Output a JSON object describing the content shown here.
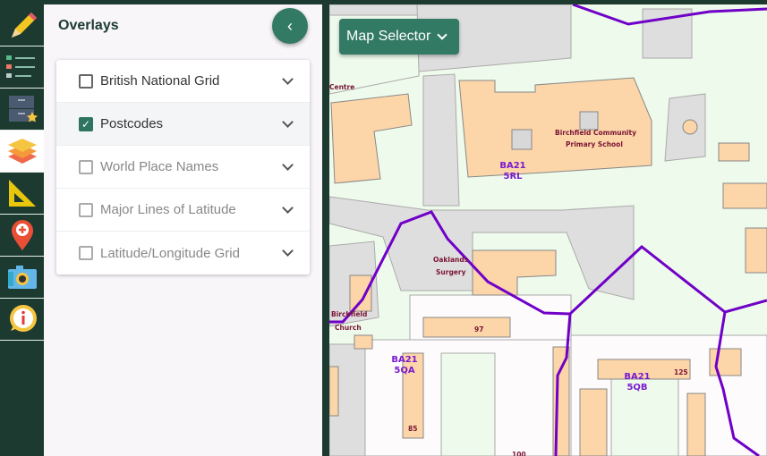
{
  "toolbar": {
    "items": [
      {
        "name": "draw",
        "icon": "pencil-icon"
      },
      {
        "name": "legend",
        "icon": "list-icon"
      },
      {
        "name": "saved-maps",
        "icon": "drawer-star-icon"
      },
      {
        "name": "overlays",
        "icon": "layers-icon",
        "active": true
      },
      {
        "name": "measure",
        "icon": "set-square-icon"
      },
      {
        "name": "add-marker",
        "icon": "map-pin-plus-icon"
      },
      {
        "name": "screenshot",
        "icon": "camera-icon"
      },
      {
        "name": "info",
        "icon": "info-icon"
      }
    ]
  },
  "panel": {
    "title": "Overlays",
    "collapse_icon": "chevron-left-icon",
    "overlays": [
      {
        "label": "British National Grid",
        "checked": false
      },
      {
        "label": "Postcodes",
        "checked": true
      },
      {
        "label": "World Place Names",
        "checked": false
      },
      {
        "label": "Major Lines of Latitude",
        "checked": false
      },
      {
        "label": "Latitude/Longitude Grid",
        "checked": false
      }
    ]
  },
  "map": {
    "selector_label": "Map Selector",
    "labels": {
      "centre": "Centre",
      "school1": "Birchfield Community",
      "school2": "Primary School",
      "surgery1": "Oaklands",
      "surgery2": "Surgery",
      "church1": "Birchfield",
      "church2": "Church",
      "n97": "97",
      "n125": "125",
      "n85": "85",
      "n100": "100"
    },
    "postcodes": {
      "p1a": "BA21",
      "p1b": "5RL",
      "p2a": "BA21",
      "p2b": "5QA",
      "p3a": "BA21",
      "p3b": "5QB"
    },
    "colors": {
      "postcode_line": "#7000c8",
      "building": "#fcd5a8",
      "road": "#dedede",
      "land": "#eefaeb",
      "accent": "#337a64"
    }
  }
}
